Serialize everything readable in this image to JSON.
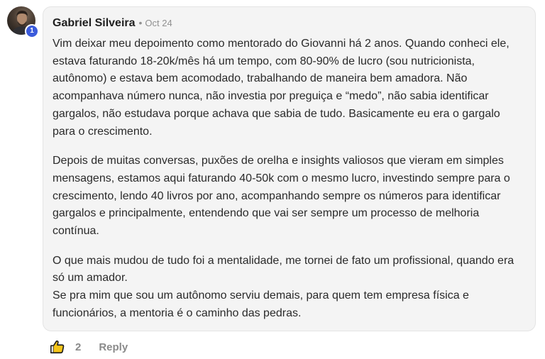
{
  "comment": {
    "author": "Gabriel Silveira",
    "separator": "•",
    "date": "Oct 24",
    "level": "1",
    "paragraphs": [
      "Vim deixar meu depoimento como mentorado do Giovanni há 2 anos. Quando conheci ele, estava faturando 18-20k/mês há um tempo, com 80-90% de lucro (sou nutricionista, autônomo) e estava bem acomodado, trabalhando de maneira bem amadora. Não acompanhava número nunca, não investia por preguiça e “medo”, não sabia identificar gargalos, não estudava porque achava que sabia de tudo. Basicamente eu era o gargalo para o crescimento.",
      "Depois de muitas conversas, puxões de orelha e insights valiosos que vieram em simples mensagens, estamos aqui faturando 40-50k com o mesmo lucro, investindo sempre para o crescimento, lendo 40 livros por ano, acompanhando sempre os números para identificar gargalos e principalmente, entendendo que vai ser sempre um processo de melhoria contínua.",
      "O que mais mudou de tudo foi a mentalidade, me tornei de fato um profissional, quando era só um amador.\nSe pra mim que sou um autônomo serviu demais, para quem tem empresa física e funcionários, a mentoria é o caminho das pedras."
    ]
  },
  "actions": {
    "like_icon": "thumbs-up-icon",
    "like_count": "2",
    "reply_label": "Reply"
  },
  "colors": {
    "badge": "#3b5bdb",
    "bubble_bg": "#f4f4f4",
    "muted_text": "#8a8a8a"
  }
}
